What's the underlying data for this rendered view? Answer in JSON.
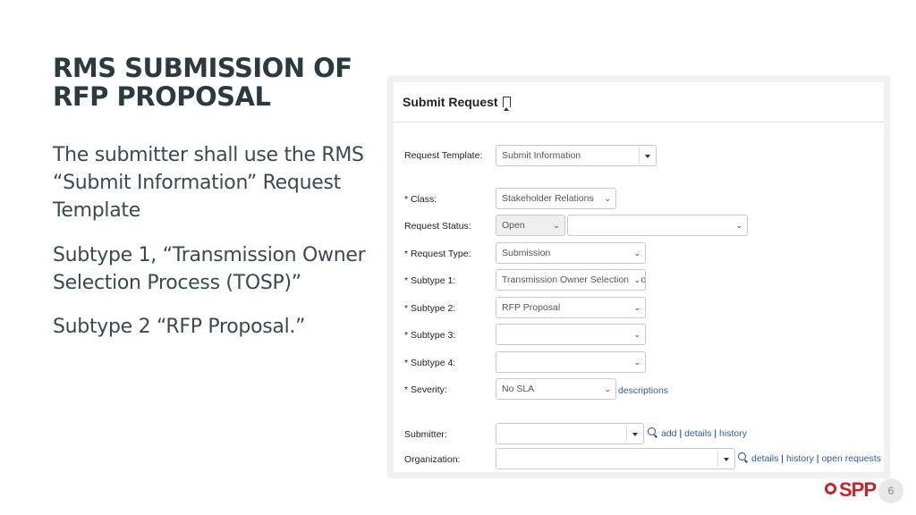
{
  "slide": {
    "title_line1": "RMS SUBMISSION OF",
    "title_line2": "RFP PROPOSAL",
    "para1": "The submitter shall use the RMS “Submit Information” Request Template",
    "para2": "Subtype 1, “Transmission Owner Selection Process (TOSP)”",
    "para3": "Subtype 2 “RFP Proposal.”",
    "page_number": "6",
    "logo_text": "SPP",
    "brand_color": "#c8232c"
  },
  "form": {
    "heading": "Submit Request",
    "heading_icon": "bookmark-icon",
    "fields": {
      "request_template": {
        "label": "Request Template:",
        "value": "Submit Information"
      },
      "class": {
        "label": "* Class:",
        "value": "Stakeholder Relations"
      },
      "request_status": {
        "label": "Request Status:",
        "value": "Open",
        "value2": ""
      },
      "request_type": {
        "label": "* Request Type:",
        "value": "Submission"
      },
      "subtype1": {
        "label": "* Subtype 1:",
        "value": "Transmission Owner Selection Proc"
      },
      "subtype2": {
        "label": "* Subtype 2:",
        "value": "RFP Proposal"
      },
      "subtype3": {
        "label": "* Subtype 3:",
        "value": ""
      },
      "subtype4": {
        "label": "* Subtype 4:",
        "value": ""
      },
      "severity": {
        "label": "* Severity:",
        "value": "No SLA",
        "link": "descriptions"
      },
      "submitter": {
        "label": "Submitter:",
        "value": "",
        "links": [
          "add",
          "details",
          "history"
        ]
      },
      "organization": {
        "label": "Organization:",
        "value": "",
        "links": [
          "details",
          "history",
          "open requests"
        ]
      }
    },
    "link_color": "#2a5db0"
  }
}
